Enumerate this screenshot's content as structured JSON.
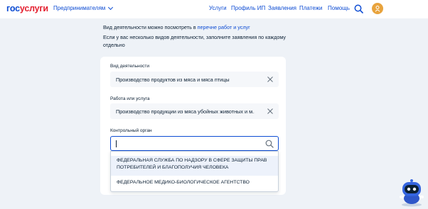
{
  "header": {
    "logo_part1": "гос",
    "logo_part2": "услуги",
    "entrepreneurs": "Предпринимателям",
    "nav": [
      "Услуги",
      "Профиль ИП",
      "Заявления",
      "Платежи",
      "Помощь"
    ]
  },
  "intro": {
    "line1_text": "Вид деятельности можно посмотреть в ",
    "line1_link": "перечне работ и услуг",
    "line2": "Если у вас несколько видов деятельности, заполните заявления по каждому",
    "line3": "отдельно"
  },
  "form": {
    "activity_label": "Вид деятельности",
    "activity_value": "Производство продуктов из мяса и мяса птицы",
    "work_label": "Работа или услуга",
    "work_value": "Производство продукции из мяса убойных животных и м...",
    "authority_label": "Контрольный орган",
    "authority_value": ""
  },
  "dropdown": {
    "options": [
      "ФЕДЕРАЛЬНАЯ СЛУЖБА ПО НАДЗОРУ В СФЕРЕ ЗАЩИТЫ ПРАВ ПОТРЕБИТЕЛЕЙ И БЛАГОПОЛУЧИЯ ЧЕЛОВЕКА",
      "ФЕДЕРАЛЬНОЕ МЕДИКО-БИОЛОГИЧЕСКОЕ АГЕНТСТВО"
    ]
  },
  "colors": {
    "accent": "#0d4cd3",
    "logo_red": "#e4202f",
    "background": "#eef2f7",
    "avatar": "#e8a33d"
  },
  "icons": [
    "chevron-down-icon",
    "search-icon",
    "avatar-icon",
    "clear-icon",
    "robot-assistant-icon"
  ]
}
